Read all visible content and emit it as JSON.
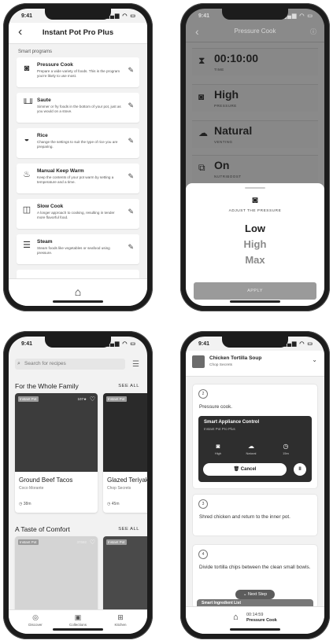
{
  "status_time": "9:41",
  "status_icons": "▂▄▆ ◠ ▭",
  "home_icon_label": "appliance-icon",
  "phone1": {
    "header_title": "Instant Pot Pro Plus",
    "back_glyph": "‹",
    "section_label": "Smart programs",
    "programs": [
      {
        "name": "Pressure Cook",
        "icon": "◙",
        "desc": "Prepare a wide variety of foods. This is the program you're likely to use most."
      },
      {
        "name": "Saute",
        "icon": "╙╜",
        "desc": "Simmer or fry foods in the bottom of your pot, just as you would on a stove."
      },
      {
        "name": "Rice",
        "icon": "◒",
        "desc": "Change the settings to suit the type of rice you are preparing."
      },
      {
        "name": "Manual Keep Warm",
        "icon": "♨",
        "desc": "Keep the contents of your pot warm by setting a temperature and a time."
      },
      {
        "name": "Slow Cook",
        "icon": "◫",
        "desc": "A longer approach to cooking, resulting in tender more flavorful food."
      },
      {
        "name": "Steam",
        "icon": "☰",
        "desc": "Steam foods like vegetables or seafood using pressure."
      }
    ],
    "edit_glyph": "✎",
    "bottom_icon": "⌂"
  },
  "phone2": {
    "header_title": "Pressure Cook",
    "back_glyph": "‹",
    "info_glyph": "ⓘ",
    "rows": [
      {
        "icon": "⧗",
        "value": "00:10:00",
        "label": "TIME"
      },
      {
        "icon": "◙",
        "value": "High",
        "label": "PRESSURE"
      },
      {
        "icon": "☁",
        "value": "Natural",
        "label": "VENTING"
      },
      {
        "icon": "⧉",
        "value": "On",
        "label": "NUTRIBOOST"
      }
    ],
    "sheet_icon": "◙",
    "adjust_label": "ADJUST THE PRESSURE",
    "options": [
      "Low",
      "High",
      "Max"
    ],
    "apply_label": "APPLY"
  },
  "phone3": {
    "search_placeholder": "Search for recipes",
    "search_icon": "⌕",
    "filter_icon": "☰",
    "section1": {
      "title": "For the Whole Family",
      "see_all": "SEE ALL"
    },
    "section2": {
      "title": "A Taste of Comfort",
      "see_all": "SEE ALL"
    },
    "cards_row1": [
      {
        "tag": "Instant Pot",
        "rating": "107★",
        "name": "Ground Beef Tacos",
        "author": "Coco Morante",
        "time": "38m"
      },
      {
        "tag": "Instant Pot",
        "rating": "",
        "name": "Glazed Teriyaki",
        "author": "Chop Secrets",
        "time": "45m"
      }
    ],
    "cards_row2": [
      {
        "tag": "Instant Pot",
        "rating": "37692",
        "name": "",
        "author": "",
        "time": ""
      },
      {
        "tag": "Instant Pot",
        "rating": "",
        "name": "",
        "author": "",
        "time": ""
      }
    ],
    "nav": [
      {
        "icon": "◎",
        "label": "Discover"
      },
      {
        "icon": "▣",
        "label": "Collections"
      },
      {
        "icon": "⊞",
        "label": "Kitchen"
      }
    ],
    "clock_glyph": "◷",
    "heart_glyph": "♡"
  },
  "phone4": {
    "recipe_title": "Chicken Tortilla Soup",
    "recipe_sub": "Chop Secrets",
    "chevron": "⌄",
    "step2": {
      "num": "2",
      "text": "Pressure cook."
    },
    "sac": {
      "title": "Smart Appliance Control",
      "subtitle": "Instant Pot Pro Plus",
      "modes": [
        {
          "icon": "◙",
          "label": "High"
        },
        {
          "icon": "☁",
          "label": "Natural"
        },
        {
          "icon": "◷",
          "label": "15m"
        }
      ],
      "cancel_label": "Cancel",
      "cancel_icon": "🗑",
      "pause_glyph": "II"
    },
    "step3": {
      "num": "3",
      "text": "Shred chicken and return to the inner pot."
    },
    "step4": {
      "num": "4",
      "text": "Divide tortilla chips between the clean small bowls."
    },
    "next_step": "⌄ Next Step",
    "ingredient_list": "Smart Ingredient List",
    "bottom_time": "00:14:59",
    "bottom_mode": "Pressure Cook",
    "bottom_icon": "⌂"
  },
  "colors": {
    "bezel": "#1c1c1c",
    "screen_bg": "#f2f2f2",
    "overlay": "#8a8a8a"
  }
}
